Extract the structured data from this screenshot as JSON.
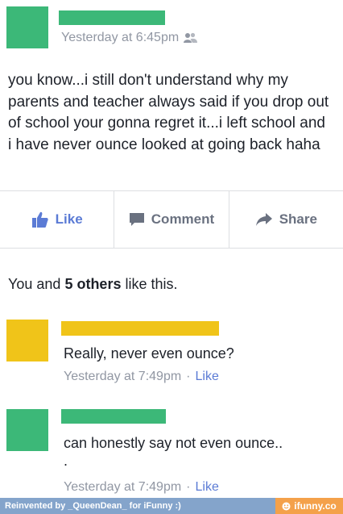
{
  "post": {
    "timestamp": "Yesterday at 6:45pm",
    "audience_icon": "friends-icon",
    "text": "you know...i still don't understand why my parents and teacher always said if you drop out of school your gonna regret it...i left school and i have never ounce looked at going back haha"
  },
  "actions": {
    "like_label": "Like",
    "comment_label": "Comment",
    "share_label": "Share"
  },
  "likes": {
    "prefix": "You and",
    "bold": "5 others",
    "suffix": "like this."
  },
  "comments": [
    {
      "text": "Really, never even ounce?",
      "timestamp": "Yesterday at 7:49pm",
      "separator": "·",
      "like_label": "Like",
      "avatar_color": "#f0c419"
    },
    {
      "text": "can honestly say not even ounce..",
      "extra": ".",
      "timestamp": "Yesterday at 7:49pm",
      "separator": "·",
      "like_label": "Like",
      "avatar_color": "#3cb878"
    }
  ],
  "footer": {
    "credit": "Reinvented by _QueenDean_ for iFunny :)",
    "logo": "ifunny.co"
  },
  "colors": {
    "redaction_green": "#3cb878",
    "redaction_yellow": "#f0c419",
    "link_blue": "#5b7bd5",
    "meta_gray": "#9197a3",
    "footer_blue": "#84a4cb",
    "footer_orange": "#f4a14a"
  }
}
